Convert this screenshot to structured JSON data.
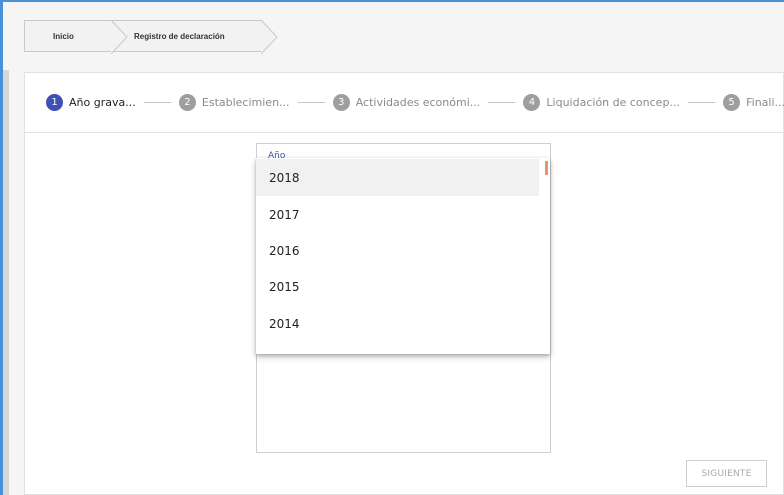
{
  "breadcrumb": {
    "items": [
      {
        "label": "Inicio"
      },
      {
        "label": "Registro de declaración"
      }
    ]
  },
  "stepper": {
    "steps": [
      {
        "number": "1",
        "label": "Año grava...",
        "active": true
      },
      {
        "number": "2",
        "label": "Establecimien...",
        "active": false
      },
      {
        "number": "3",
        "label": "Actividades económi...",
        "active": false
      },
      {
        "number": "4",
        "label": "Liquidación de concep...",
        "active": false
      },
      {
        "number": "5",
        "label": "Finali...",
        "active": false
      }
    ]
  },
  "year_field": {
    "label": "Año",
    "options": [
      "2018",
      "2017",
      "2016",
      "2015",
      "2014"
    ],
    "highlighted": "2018"
  },
  "actions": {
    "next_label": "SIGUIENTE"
  },
  "colors": {
    "accent": "#3f51b5",
    "frame_border": "#4a90d9",
    "scroll_thumb": "#e8916b"
  }
}
